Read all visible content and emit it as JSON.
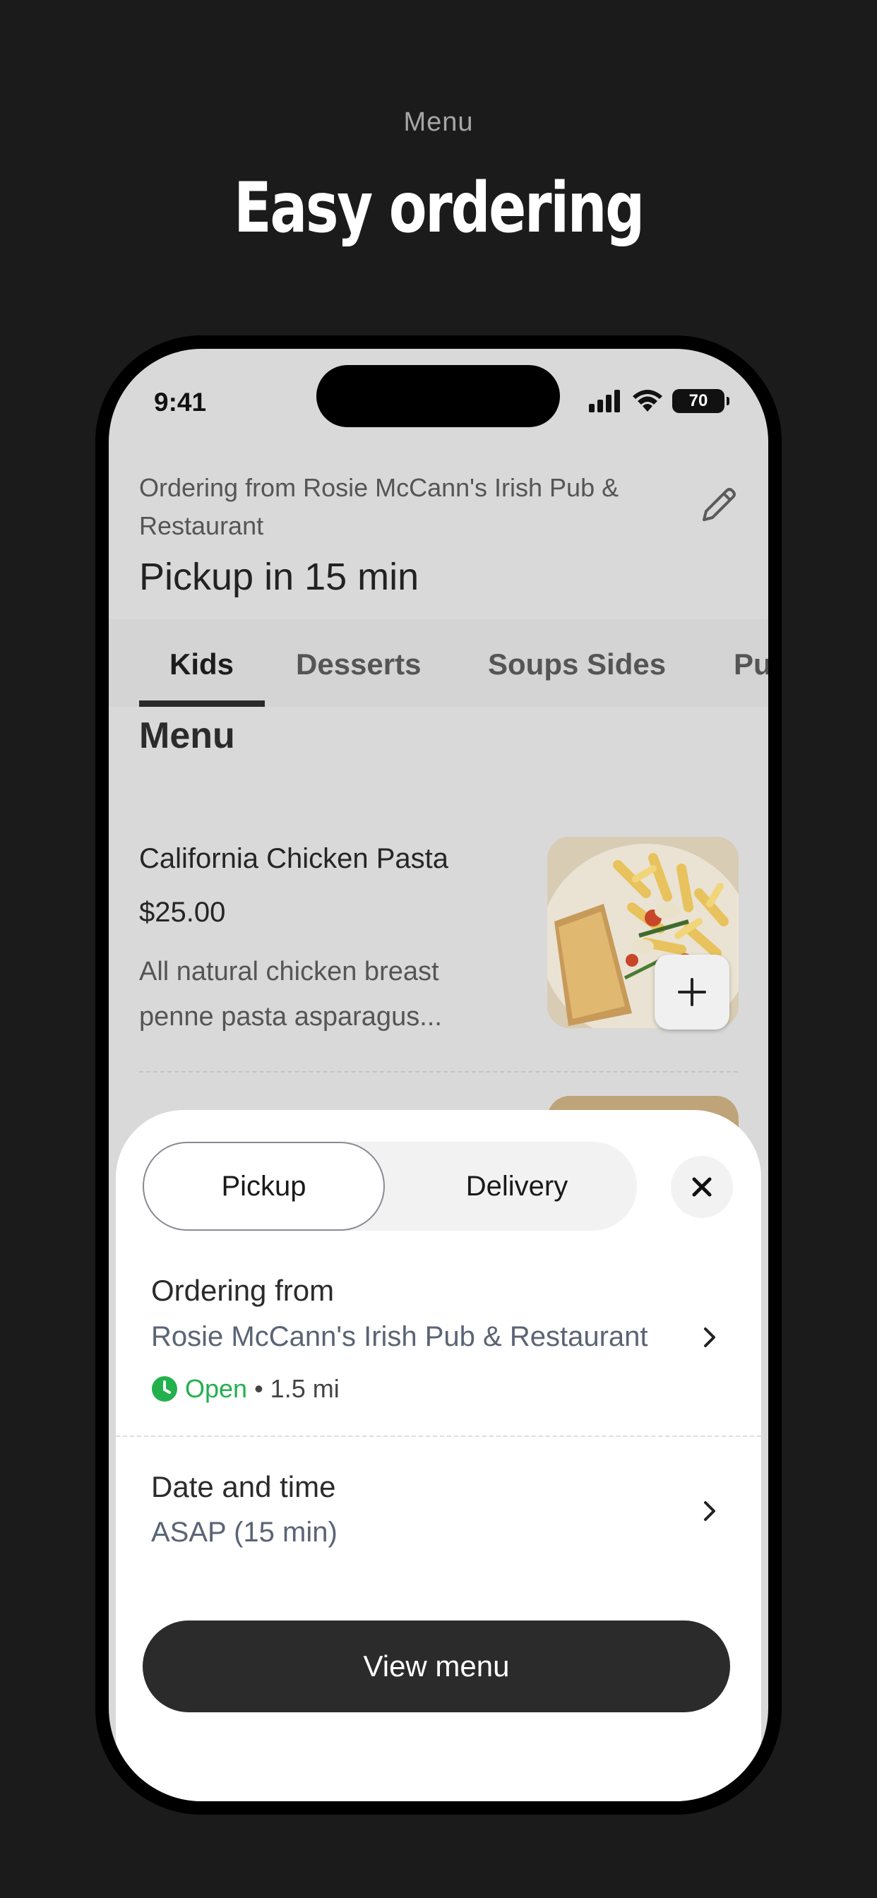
{
  "caption": "Menu",
  "headline": "Easy ordering",
  "status_bar": {
    "time": "9:41",
    "battery": "70"
  },
  "header": {
    "ordering_from": "Ordering from Rosie McCann's Irish Pub & Restaurant",
    "pickup_title": "Pickup in 15 min",
    "edit_icon": "pencil-icon"
  },
  "tabs": [
    {
      "label": "Kids",
      "active": true
    },
    {
      "label": "Desserts",
      "active": false
    },
    {
      "label": "Soups Sides",
      "active": false
    },
    {
      "label": "Pu",
      "active": false
    }
  ],
  "menu": {
    "heading": "Menu",
    "items": [
      {
        "name": "California Chicken Pasta",
        "price": "$25.00",
        "description": "All natural chicken breast penne pasta asparagus..."
      }
    ]
  },
  "sheet": {
    "segments": {
      "pickup": "Pickup",
      "delivery": "Delivery",
      "selected": "Pickup"
    },
    "ordering_from_title": "Ordering from",
    "restaurant": "Rosie McCann's Irish Pub & Restaurant",
    "open_status": "Open",
    "distance": "• 1.5 mi",
    "date_time_title": "Date and time",
    "date_time_value": "ASAP (15 min)",
    "view_menu": "View menu"
  },
  "colors": {
    "open_green": "#22b14c",
    "primary_button": "#2b2b2b",
    "background": "#1b1b1b"
  }
}
